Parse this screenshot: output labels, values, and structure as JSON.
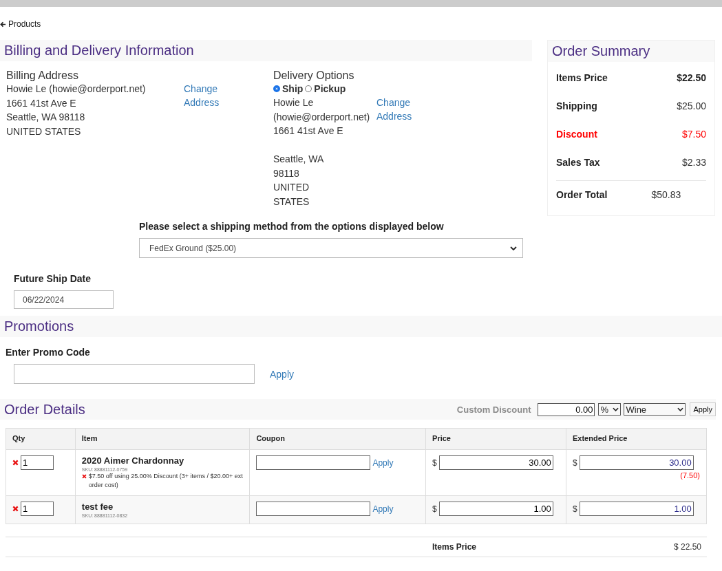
{
  "back_link": {
    "label": "Products"
  },
  "billing_delivery": {
    "title": "Billing and Delivery Information",
    "billing": {
      "heading": "Billing Address",
      "lines": [
        "Howie Le (howie@orderport.net)",
        "1661 41st Ave E",
        "Seattle, WA 98118",
        "UNITED STATES"
      ],
      "change_link": "Change Address"
    },
    "delivery": {
      "heading": "Delivery Options",
      "options": [
        {
          "label": "Ship",
          "selected": true
        },
        {
          "label": "Pickup",
          "selected": false
        }
      ],
      "line_groups": [
        [
          "Howie Le",
          "(howie@orderport.net)",
          "1661 41st Ave E"
        ],
        [
          "Seattle, WA",
          "98118",
          "UNITED",
          "STATES"
        ]
      ],
      "change_link": "Change Address"
    },
    "shipping_method": {
      "label": "Please select a shipping method from the options displayed below",
      "value": "FedEx Ground ($25.00)"
    },
    "ship_date": {
      "label": "Future Ship Date",
      "value": "06/22/2024"
    }
  },
  "order_summary": {
    "title": "Order Summary",
    "rows": [
      {
        "label": "Items Price",
        "value": "$22.50",
        "kind": "bold"
      },
      {
        "label": "Shipping",
        "value": "$25.00",
        "kind": "normal"
      },
      {
        "label": "Discount",
        "value": "$7.50",
        "kind": "discount"
      },
      {
        "label": "Sales Tax",
        "value": "$2.33",
        "kind": "normal"
      }
    ],
    "total": {
      "label": "Order Total",
      "value": "$50.83"
    }
  },
  "promotions": {
    "title": "Promotions",
    "label": "Enter Promo Code",
    "apply": "Apply"
  },
  "order_details": {
    "title": "Order Details",
    "custom_discount": {
      "label": "Custom Discount",
      "amount": "0.00",
      "unit": "%",
      "category": "Wine",
      "apply": "Apply"
    },
    "columns": [
      "Qty",
      "Item",
      "Coupon",
      "Price",
      "Extended Price"
    ],
    "rows": [
      {
        "qty": "1",
        "name": "2020 Aimer Chardonnay",
        "sku": "SKU: 88881112-0759",
        "discount_note": "$7.50 off using 25.00% Discount (3+ items / $20.00+ ext order cost)",
        "coupon_apply": "Apply",
        "currency": "$",
        "price": "30.00",
        "ext_currency": "$",
        "extended_price": "30.00",
        "discount": "(7.50)"
      },
      {
        "qty": "1",
        "name": "test fee",
        "sku": "SKU: 88881112-0832",
        "coupon_apply": "Apply",
        "currency": "$",
        "price": "1.00",
        "ext_currency": "$",
        "extended_price": "1.00"
      }
    ],
    "totals": [
      {
        "label": "Items Price",
        "value": "$ 22.50"
      }
    ]
  }
}
